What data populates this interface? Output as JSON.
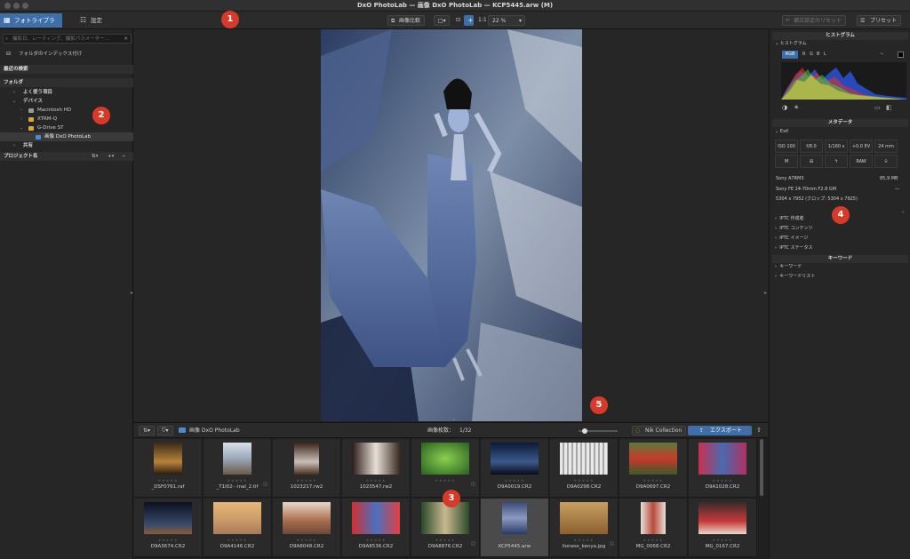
{
  "window": {
    "title": "DxO PhotoLab — 画像 DxO PhotoLab — KCP5445.arw (M)"
  },
  "toolbar": {
    "tab_library": "フォトライブラリ",
    "tab_settings": "設定",
    "compare": "画像比較",
    "one_to_one": "1:1",
    "zoom": "22 %",
    "reset": "補正設定のリセット",
    "presets": "プリセット"
  },
  "left": {
    "search_placeholder": "撮影日、レーティング、撮影パラメーター...",
    "index_folder": "フォルダのインデックス付け",
    "recent_searches": "最近の検索",
    "folders_header": "フォルダ",
    "favorites": "よく使う項目",
    "devices": "デバイス",
    "items": [
      "Macintosh HD",
      "XTRM-Q",
      "G-Drive ST",
      "画像 DxO PhotoLab"
    ],
    "shared": "共有",
    "projects": "プロジェクト名"
  },
  "badges": [
    "1",
    "2",
    "3",
    "4",
    "5"
  ],
  "right": {
    "histogram_header": "ヒストグラム",
    "histogram_label": "ヒストグラム",
    "channels": [
      "RGB",
      "R",
      "G",
      "B",
      "L"
    ],
    "metadata_header": "メタデータ",
    "exif_label": "Exif",
    "exif_row1": [
      "ISO 100",
      "f/8.0",
      "1/160 s",
      "+0.0 EV",
      "24 mm"
    ],
    "exif_row2": [
      "M",
      "",
      "",
      "RAW",
      ""
    ],
    "camera": "Sony A7RM3",
    "size": "85,9 MB",
    "lens": "Sony FE 24-70mm F2.8 GM",
    "dims": "5304 x 7952 (クロップ: 5304 x 7925)",
    "iptc": [
      "IPTC 作成者",
      "IPTC コンテンツ",
      "IPTC イメージ",
      "IPTC ステータス"
    ],
    "keywords_header": "キーワード",
    "keyword_items": [
      "キーワード",
      "キーワードリスト"
    ]
  },
  "filmstrip": {
    "folder": "画像 DxO PhotoLab",
    "count_label": "画像枚数：",
    "count": "1/32",
    "nik": "Nik Collection",
    "export": "エクスポート",
    "stars": "★★★★★",
    "row1": [
      "_DSF0761.raf",
      "_T1I02···inal_2.tif",
      "1023217.rw2",
      "1023547.rw2",
      "",
      "D9A0019.CR2",
      "D9A0298.CR2",
      "D9A0697.CR2",
      "D9A1028.CR2"
    ],
    "row2": [
      "D9A3674.CR2",
      "D9A4146.CR2",
      "D9A8048.CR2",
      "D9A8536.CR2",
      "D9A8876.CR2",
      "KCP5445.arw",
      "lioness_kenya.jpg",
      "MG_0068.CR2",
      "MG_0167.CR2"
    ]
  }
}
